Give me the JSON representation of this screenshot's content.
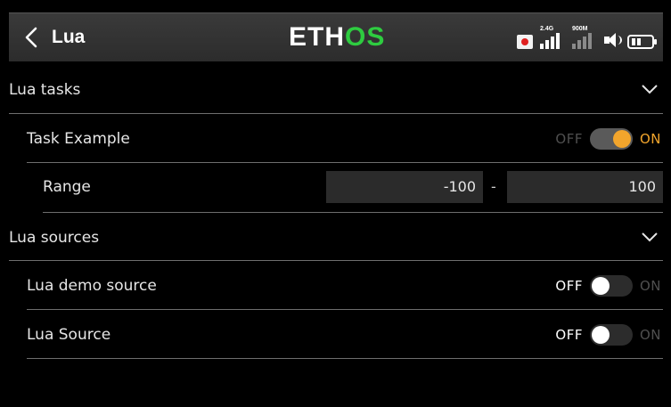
{
  "header": {
    "back_icon": "chevron-left-icon",
    "title": "Lua",
    "logo": {
      "part1": "ETH",
      "part2": "OS"
    },
    "status": {
      "rec_icon": "record-icon",
      "signal_24g_label": "2.4G",
      "signal_900m_label": "900M",
      "speaker_icon": "speaker-icon",
      "battery_icon": "battery-icon"
    }
  },
  "sections": {
    "lua_tasks": {
      "label": "Lua tasks",
      "expand_icon": "chevron-down-icon",
      "task_example": {
        "label": "Task Example",
        "toggle": {
          "off_label": "OFF",
          "on_label": "ON",
          "state": "on"
        }
      },
      "range": {
        "label": "Range",
        "min": "-100",
        "separator": "-",
        "max": "100"
      }
    },
    "lua_sources": {
      "label": "Lua sources",
      "expand_icon": "chevron-down-icon",
      "demo_source": {
        "label": "Lua demo source",
        "toggle": {
          "off_label": "OFF",
          "on_label": "ON",
          "state": "off"
        }
      },
      "lua_source": {
        "label": "Lua Source",
        "toggle": {
          "off_label": "OFF",
          "on_label": "ON",
          "state": "off"
        }
      }
    }
  },
  "colors": {
    "accent": "#f2a52c",
    "logo_accent": "#2ecc40",
    "record": "#e02020"
  }
}
